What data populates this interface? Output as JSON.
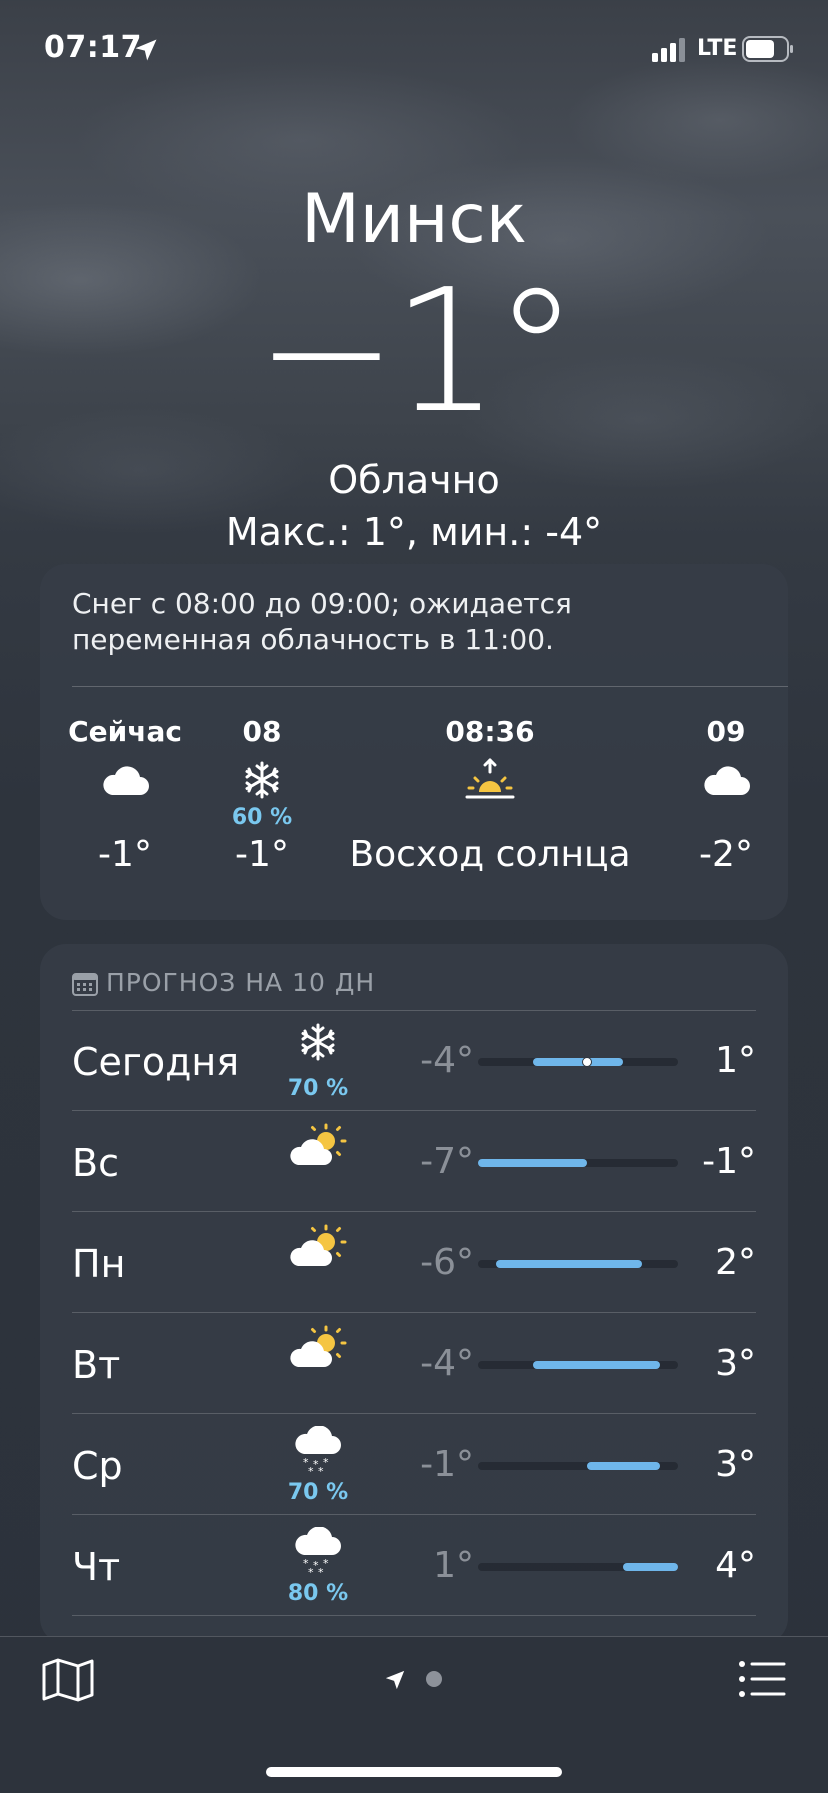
{
  "status": {
    "time": "07:17",
    "network": "LTE"
  },
  "header": {
    "city": "Минск",
    "temperature": "−1°",
    "condition": "Облачно",
    "hilo": "Макс.: 1°, мин.: -4°"
  },
  "hourly": {
    "summary": "Снег с 08:00 до 09:00; ожидается переменная облачность в 11:00.",
    "items": [
      {
        "time": "Сейчас",
        "icon": "cloud-icon",
        "precip": "",
        "temp": "-1°"
      },
      {
        "time": "08",
        "icon": "snowflake-icon",
        "precip": "60 %",
        "temp": "-1°"
      },
      {
        "time": "08:36",
        "icon": "sunrise-icon",
        "precip": "",
        "temp": "Восход солнца"
      },
      {
        "time": "09",
        "icon": "cloud-icon",
        "precip": "",
        "temp": "-2°"
      }
    ]
  },
  "daily": {
    "header": "ПРОГНОЗ НА 10 ДН",
    "range_min": -7,
    "range_max": 4,
    "days": [
      {
        "name": "Сегодня",
        "icon": "snowflake-icon",
        "precip": "70 %",
        "low": "-4°",
        "high": "1°",
        "low_value": -4,
        "high_value": 1,
        "current_value": -1
      },
      {
        "name": "Вс",
        "icon": "partly-sunny-icon",
        "precip": "",
        "low": "-7°",
        "high": "-1°",
        "low_value": -7,
        "high_value": -1
      },
      {
        "name": "Пн",
        "icon": "partly-sunny-icon",
        "precip": "",
        "low": "-6°",
        "high": "2°",
        "low_value": -6,
        "high_value": 2
      },
      {
        "name": "Вт",
        "icon": "partly-sunny-icon",
        "precip": "",
        "low": "-4°",
        "high": "3°",
        "low_value": -4,
        "high_value": 3
      },
      {
        "name": "Ср",
        "icon": "snow-cloud-icon",
        "precip": "70 %",
        "low": "-1°",
        "high": "3°",
        "low_value": -1,
        "high_value": 3
      },
      {
        "name": "Чт",
        "icon": "snow-cloud-icon",
        "precip": "80 %",
        "low": "1°",
        "high": "4°",
        "low_value": 1,
        "high_value": 4
      }
    ]
  },
  "colors": {
    "accent_blue": "#6fb6ea",
    "precip_blue": "#7ac8ef",
    "sun_yellow": "#f5c542"
  }
}
